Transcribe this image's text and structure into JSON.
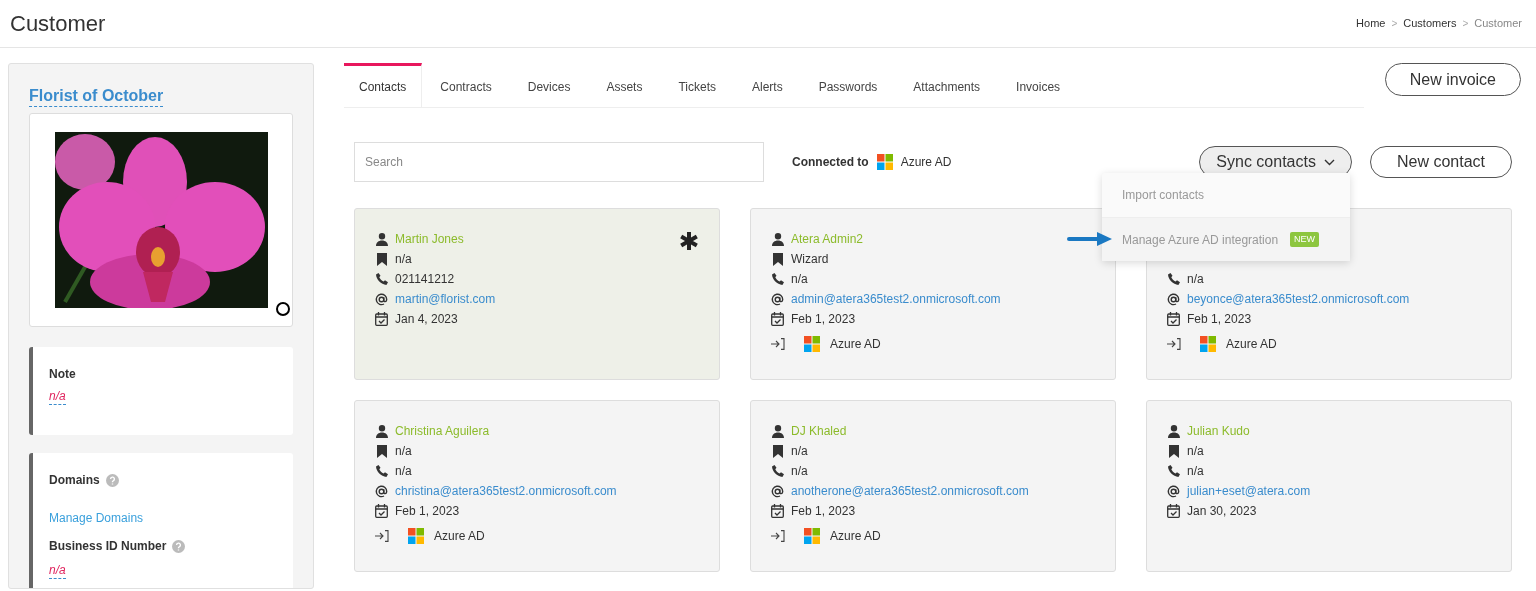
{
  "page_title": "Customer",
  "breadcrumbs": [
    {
      "label": "Home",
      "current": false
    },
    {
      "separator": ">",
      "label": "Customers",
      "current": false
    },
    {
      "separator": ">",
      "label": "Customer",
      "current": true
    }
  ],
  "sidebar": {
    "customer_name": "Florist of October",
    "note": {
      "label": "Note",
      "value": "n/a"
    },
    "details": {
      "domains_label": "Domains",
      "manage_link": "Manage Domains",
      "business_id_label": "Business ID Number",
      "business_id_value": "n/a"
    }
  },
  "tabs": [
    {
      "label": "Contacts",
      "selected": true
    },
    {
      "label": "Contracts",
      "selected": false
    },
    {
      "label": "Devices",
      "selected": false
    },
    {
      "label": "Assets",
      "selected": false
    },
    {
      "label": "Tickets",
      "selected": false
    },
    {
      "label": "Alerts",
      "selected": false
    },
    {
      "label": "Passwords",
      "selected": false
    },
    {
      "label": "Attachments",
      "selected": false
    },
    {
      "label": "Invoices",
      "selected": false
    }
  ],
  "new_invoice_button": "New invoice",
  "search": {
    "placeholder": "Search"
  },
  "connection": {
    "label": "Connected to",
    "service": "Azure AD"
  },
  "sync_button": "Sync contacts",
  "new_contact_button": "New contact",
  "sync_menu": {
    "expanded": true,
    "items": [
      {
        "label": "Import contacts"
      },
      {
        "label": "Manage Azure AD integration",
        "badge": "NEW"
      }
    ]
  },
  "contacts": [
    {
      "name": "Martin Jones",
      "title": "n/a",
      "phone": "021141212",
      "email": "martin@florist.com",
      "date": "Jan 4, 2023",
      "primary": true
    },
    {
      "name": "Atera Admin2",
      "title": "Wizard",
      "phone": "n/a",
      "email": "admin@atera365test2.onmicrosoft.com",
      "date": "Feb 1, 2023",
      "source": "Azure AD",
      "primary": false
    },
    {
      "phone": "n/a",
      "email": "beyonce@atera365test2.onmicrosoft.com",
      "date": "Feb 1, 2023",
      "source": "Azure AD",
      "primary": false
    },
    {
      "name": "Christina Aguilera",
      "title": "n/a",
      "phone": "n/a",
      "email": "christina@atera365test2.onmicrosoft.com",
      "date": "Feb 1, 2023",
      "source": "Azure AD",
      "primary": false
    },
    {
      "name": "DJ Khaled",
      "title": "n/a",
      "phone": "n/a",
      "email": "anotherone@atera365test2.onmicrosoft.com",
      "date": "Feb 1, 2023",
      "source": "Azure AD",
      "primary": false
    },
    {
      "name": "Julian Kudo",
      "title": "n/a",
      "phone": "n/a",
      "email": "julian+eset@atera.com",
      "date": "Jan 30, 2023",
      "primary": false
    }
  ]
}
